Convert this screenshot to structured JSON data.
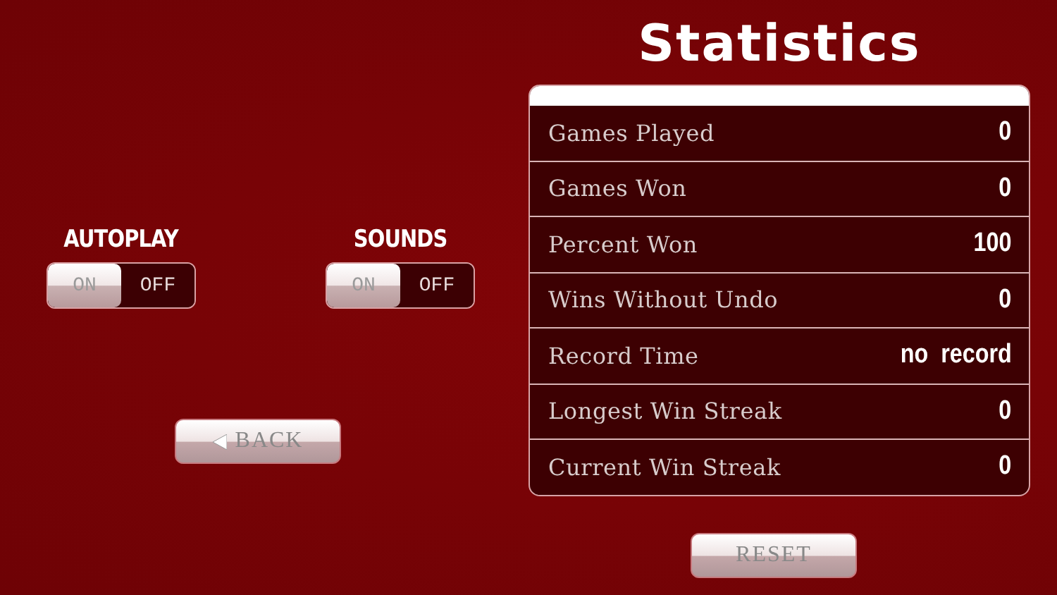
{
  "settings": [
    {
      "label": "AUTOPLAY",
      "on_label": "ON",
      "off_label": "OFF",
      "on": true
    },
    {
      "label": "SOUNDS",
      "on_label": "ON",
      "off_label": "OFF",
      "on": true
    }
  ],
  "back_button": {
    "label": "BACK"
  },
  "statistics": {
    "title": "Statistics",
    "rows": [
      {
        "label": "Games Played",
        "value": "0"
      },
      {
        "label": "Games Won",
        "value": "0"
      },
      {
        "label": "Percent Won",
        "value": "100"
      },
      {
        "label": "Wins Without Undo",
        "value": "0"
      },
      {
        "label": "Record Time",
        "value": "no  record"
      },
      {
        "label": "Longest Win Streak",
        "value": "0"
      },
      {
        "label": "Current Win Streak",
        "value": "0"
      }
    ]
  },
  "reset_button": {
    "label": "RESET"
  }
}
